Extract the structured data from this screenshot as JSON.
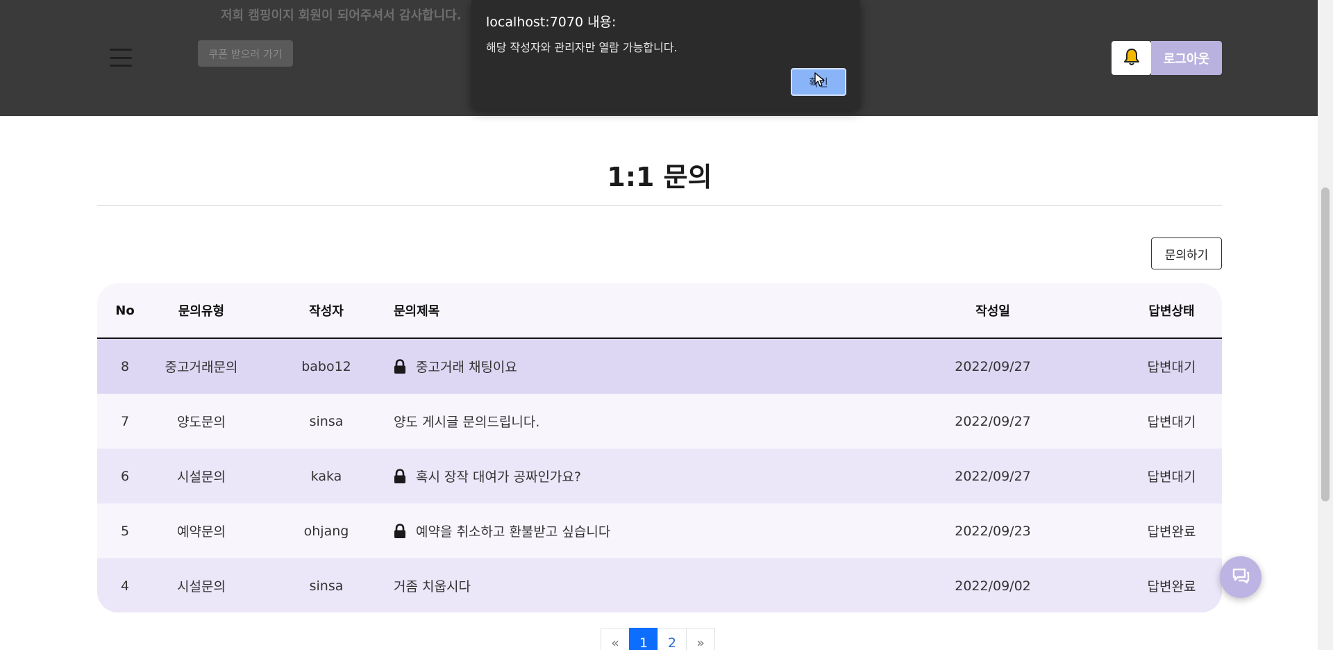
{
  "header": {
    "promo_text": "저희 캠핑이지 회원이 되어주셔서 감사합니다.",
    "promo_button_label": "쿠폰 받으러 가기",
    "logout_label": "로그아웃"
  },
  "dialog": {
    "title": "localhost:7070 내용:",
    "message": "해당 작성자와 관리자만 열람 가능합니다.",
    "ok_label": "확인"
  },
  "main": {
    "title": "1:1 문의",
    "inquiry_button_label": "문의하기"
  },
  "table": {
    "headers": {
      "no": "No",
      "type": "문의유형",
      "writer": "작성자",
      "title": "문의제목",
      "date": "작성일",
      "status": "답변상태"
    },
    "rows": [
      {
        "no": "8",
        "type": "중고거래문의",
        "writer": "babo12",
        "title": "중고거래 채팅이요",
        "locked": true,
        "date": "2022/09/27",
        "status": "답변대기",
        "bg": "#ddd7f3"
      },
      {
        "no": "7",
        "type": "양도문의",
        "writer": "sinsa",
        "title": "양도 게시글 문의드립니다.",
        "locked": false,
        "date": "2022/09/27",
        "status": "답변대기",
        "bg": "#f8f5fd"
      },
      {
        "no": "6",
        "type": "시설문의",
        "writer": "kaka",
        "title": "혹시 장작 대여가 공짜인가요?",
        "locked": true,
        "date": "2022/09/27",
        "status": "답변대기",
        "bg": "#ebe6f8"
      },
      {
        "no": "5",
        "type": "예약문의",
        "writer": "ohjang",
        "title": "예약을 취소하고 환불받고 싶습니다",
        "locked": true,
        "date": "2022/09/23",
        "status": "답변완료",
        "bg": "#f8f5fd"
      },
      {
        "no": "4",
        "type": "시설문의",
        "writer": "sinsa",
        "title": "거좀 치웁시다",
        "locked": false,
        "date": "2022/09/02",
        "status": "답변완료",
        "bg": "#ebe6f8"
      }
    ]
  },
  "pagination": {
    "prev": "«",
    "pages": [
      "1",
      "2"
    ],
    "active_page": "1",
    "next": "»"
  },
  "icons": {
    "bell": "bell-icon",
    "lock": "lock-icon",
    "chat": "chat-icon",
    "menu": "hamburger-menu-icon"
  },
  "colors": {
    "header_bg": "#3a3a3a",
    "accent_purple": "#b9b2de",
    "highlight_row": "#ddd7f3",
    "active_page": "#0d6efd"
  }
}
